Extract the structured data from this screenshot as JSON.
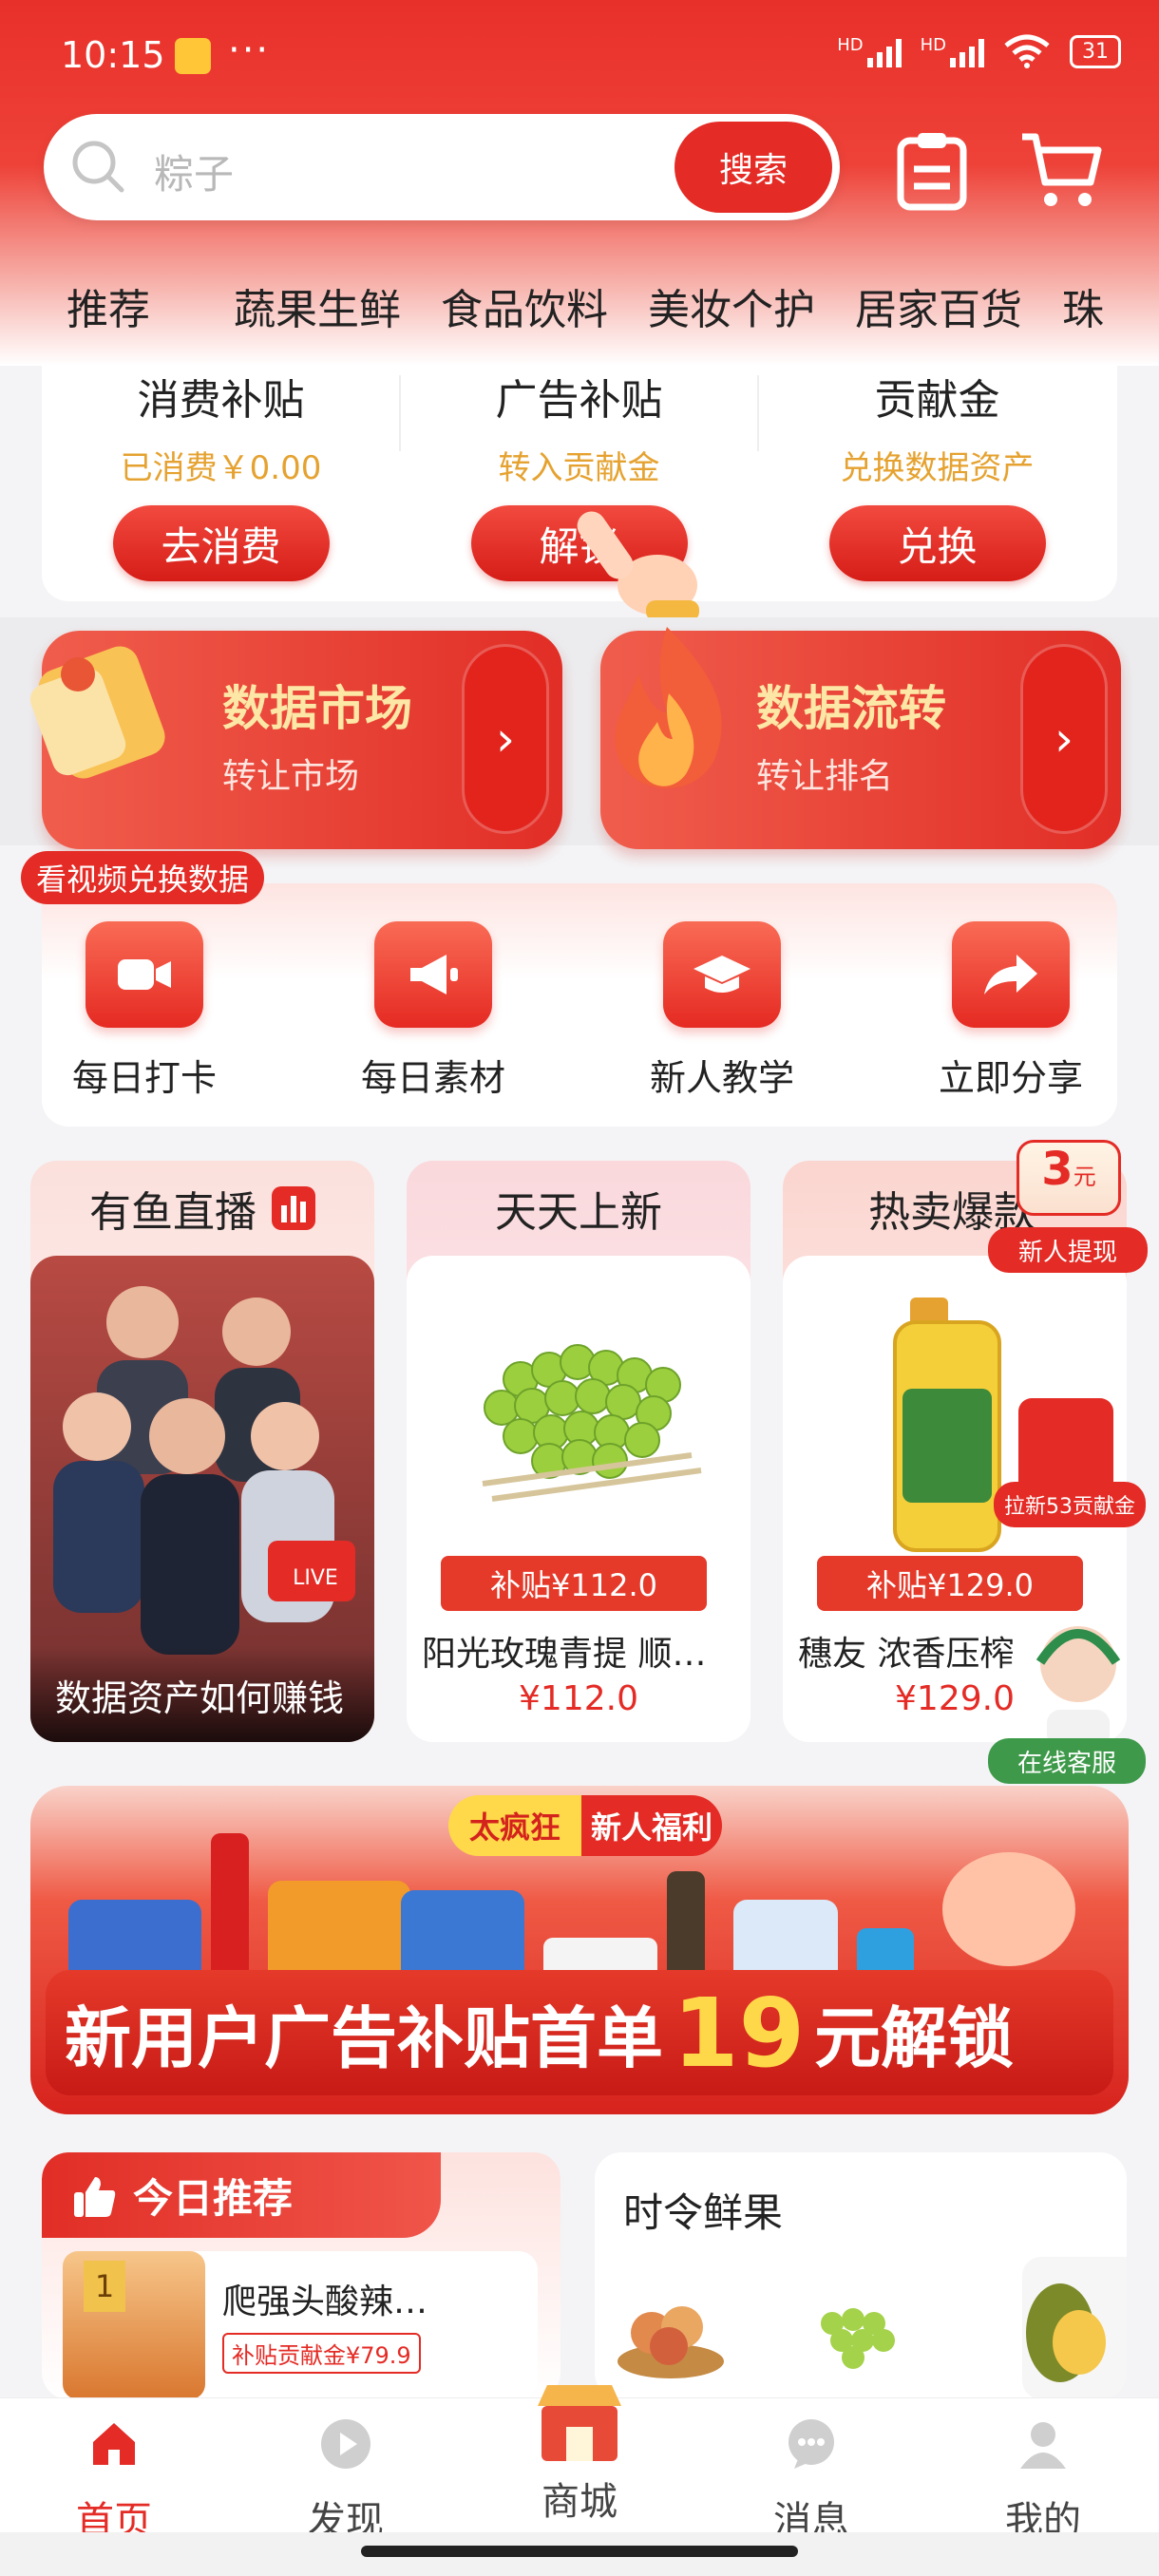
{
  "status": {
    "time": "10:15",
    "dots": "···",
    "net1": "HD",
    "net2": "HD",
    "battery": "31"
  },
  "search": {
    "placeholder": "粽子",
    "button": "搜索"
  },
  "tabs": [
    "推荐",
    "蔬果生鲜",
    "食品饮料",
    "美妆个护",
    "居家百货",
    "珠"
  ],
  "subsidy": [
    {
      "title": "消费补贴",
      "sub": "已消费￥0.00",
      "button": "去消费"
    },
    {
      "title": "广告补贴",
      "sub": "转入贡献金",
      "button": "解锁"
    },
    {
      "title": "贡献金",
      "sub": "兑换数据资产",
      "button": "兑换"
    }
  ],
  "data_cards": [
    {
      "title": "数据市场",
      "sub": "转让市场"
    },
    {
      "title": "数据流转",
      "sub": "转让排名"
    }
  ],
  "quick": {
    "tag": "看视频兑换数据",
    "items": [
      {
        "label": "每日打卡",
        "icon": "camera-icon"
      },
      {
        "label": "每日素材",
        "icon": "megaphone-icon"
      },
      {
        "label": "新人教学",
        "icon": "graduation-cap-icon"
      },
      {
        "label": "立即分享",
        "icon": "share-arrow-icon"
      }
    ]
  },
  "panels": {
    "live": {
      "title": "有鱼直播",
      "caption": "数据资产如何赚钱",
      "live_badge": "LIVE"
    },
    "new": {
      "title": "天天上新",
      "subsidy": "补贴¥112.0",
      "name": "阳光玫瑰青提 顺…",
      "price": "¥112.0"
    },
    "hot": {
      "title": "热卖爆款",
      "subsidy": "补贴¥129.0",
      "name": "穗友 浓香压榨",
      "price": "¥129.0"
    }
  },
  "floating": {
    "cash_amount": "3",
    "cash_unit": "元",
    "cash_label": "新人提现",
    "invite_label": "拉新53贡献金",
    "service_label": "在线客服"
  },
  "promo": {
    "pill_left": "太疯狂",
    "pill_right": "新人福利",
    "text_before": "新用户广告补贴首单",
    "number": "19",
    "text_after": "元解锁"
  },
  "today": {
    "title": "今日推荐",
    "rank": "1",
    "name": "爬强头酸辣…",
    "subsidy": "补贴贡献金¥79.9"
  },
  "fruit": {
    "title": "时令鲜果"
  },
  "nav": [
    {
      "label": "首页",
      "active": true
    },
    {
      "label": "发现",
      "active": false
    },
    {
      "label": "商城",
      "active": false
    },
    {
      "label": "消息",
      "active": false
    },
    {
      "label": "我的",
      "active": false
    }
  ],
  "colors": {
    "accent": "#e42b25",
    "gold": "#e5a230"
  }
}
